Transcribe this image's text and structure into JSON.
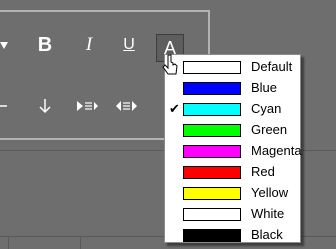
{
  "toolbar": {
    "bold": "B",
    "italic": "I",
    "underline": "U",
    "font_color": "A"
  },
  "color_menu": {
    "items": [
      {
        "label": "Default",
        "color": "#ffffff",
        "checked": false
      },
      {
        "label": "Blue",
        "color": "#0000ff",
        "checked": false
      },
      {
        "label": "Cyan",
        "color": "#00ffff",
        "checked": true
      },
      {
        "label": "Green",
        "color": "#00ff00",
        "checked": false
      },
      {
        "label": "Magenta",
        "color": "#ff00ff",
        "checked": false
      },
      {
        "label": "Red",
        "color": "#ff0000",
        "checked": false
      },
      {
        "label": "Yellow",
        "color": "#ffff00",
        "checked": false
      },
      {
        "label": "White",
        "color": "#ffffff",
        "checked": false
      },
      {
        "label": "Black",
        "color": "#000000",
        "checked": false
      }
    ],
    "check_mark": "✔"
  }
}
